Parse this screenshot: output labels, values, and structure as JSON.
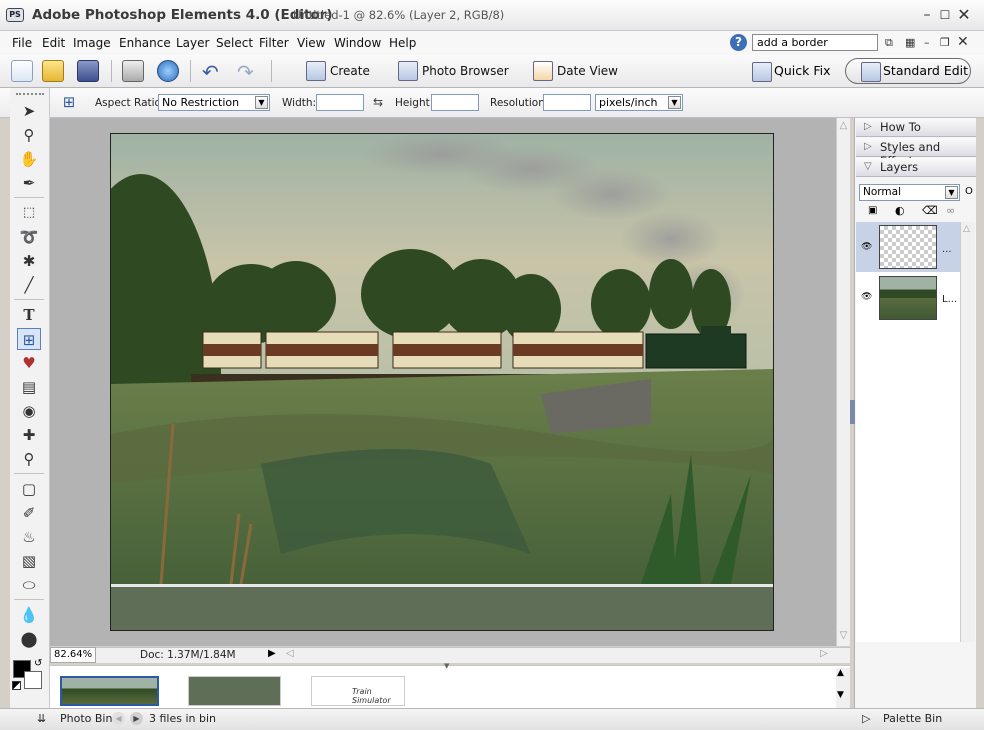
{
  "window": {
    "app_title": "Adobe Photoshop Elements 4.0 (Editor)",
    "doc_title": "Untitled-1 @ 82.6% (Layer 2, RGB/8)",
    "logo_text": "PS"
  },
  "menu": [
    "File",
    "Edit",
    "Image",
    "Enhance",
    "Layer",
    "Select",
    "Filter",
    "View",
    "Window",
    "Help"
  ],
  "search": {
    "value": "add a border"
  },
  "shortcuts": {
    "create": "Create",
    "photo_browser": "Photo Browser",
    "date_view": "Date View",
    "quick_fix": "Quick Fix",
    "standard_edit": "Standard Edit"
  },
  "options": {
    "aspect_ratio_label": "Aspect Ratio:",
    "aspect_ratio_value": "No Restriction",
    "width_label": "Width:",
    "width_value": "",
    "height_label": "Height:",
    "height_value": "",
    "resolution_label": "Resolution:",
    "resolution_value": "",
    "units_value": "pixels/inch"
  },
  "status": {
    "zoom": "82.64%",
    "doc_size": "Doc: 1.37M/1.84M"
  },
  "palettes": {
    "how_to": "How To",
    "styles_effects": "Styles and Effects",
    "layers": "Layers",
    "blend_mode": "Normal",
    "opacity_hint": "O"
  },
  "layers": [
    {
      "name": "...",
      "type": "transparent"
    },
    {
      "name": "L...",
      "type": "photo"
    }
  ],
  "photo_bin": {
    "label": "Photo Bin",
    "files_count": "3 files in bin",
    "palette_bin": "Palette Bin",
    "thumb3_text": "Train Simulator"
  },
  "colors": {
    "accent": "#3d6fb8",
    "tool_highlight": "#d9e4f5"
  }
}
